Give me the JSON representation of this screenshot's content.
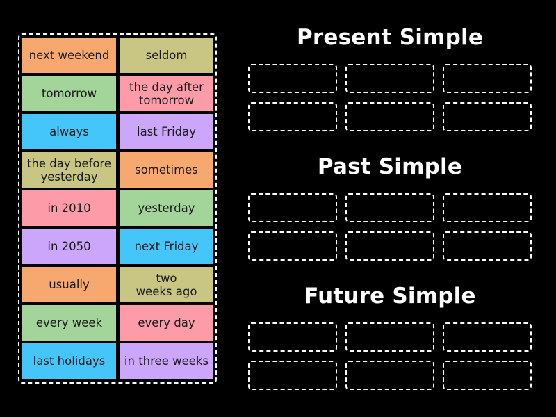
{
  "colors": {
    "orange": "#f7a86f",
    "olive": "#c9c582",
    "green": "#a3d49a",
    "pink": "#fd9ca8",
    "blue": "#45c6fb",
    "purple": "#cba6fa"
  },
  "cards": [
    {
      "label": "next weekend",
      "color": "#f7a86f"
    },
    {
      "label": "seldom",
      "color": "#c9c582"
    },
    {
      "label": "tomorrow",
      "color": "#a3d49a"
    },
    {
      "label": "the day after tomorrow",
      "color": "#fd9ca8"
    },
    {
      "label": "always",
      "color": "#45c6fb"
    },
    {
      "label": "last Friday",
      "color": "#cba6fa"
    },
    {
      "label": "the day before yesterday",
      "color": "#c9c582"
    },
    {
      "label": "sometimes",
      "color": "#f7a86f"
    },
    {
      "label": "in 2010",
      "color": "#fd9ca8"
    },
    {
      "label": "yesterday",
      "color": "#a3d49a"
    },
    {
      "label": "in 2050",
      "color": "#cba6fa"
    },
    {
      "label": "next Friday",
      "color": "#45c6fb"
    },
    {
      "label": "usually",
      "color": "#f7a86f"
    },
    {
      "label": "two weeks ago",
      "color": "#c9c582"
    },
    {
      "label": "every week",
      "color": "#a3d49a"
    },
    {
      "label": "every day",
      "color": "#fd9ca8"
    },
    {
      "label": "last holidays",
      "color": "#45c6fb"
    },
    {
      "label": "in three weeks",
      "color": "#cba6fa"
    }
  ],
  "groups": [
    {
      "title": "Present Simple",
      "slots": 6
    },
    {
      "title": "Past Simple",
      "slots": 6
    },
    {
      "title": "Future Simple",
      "slots": 6
    }
  ]
}
